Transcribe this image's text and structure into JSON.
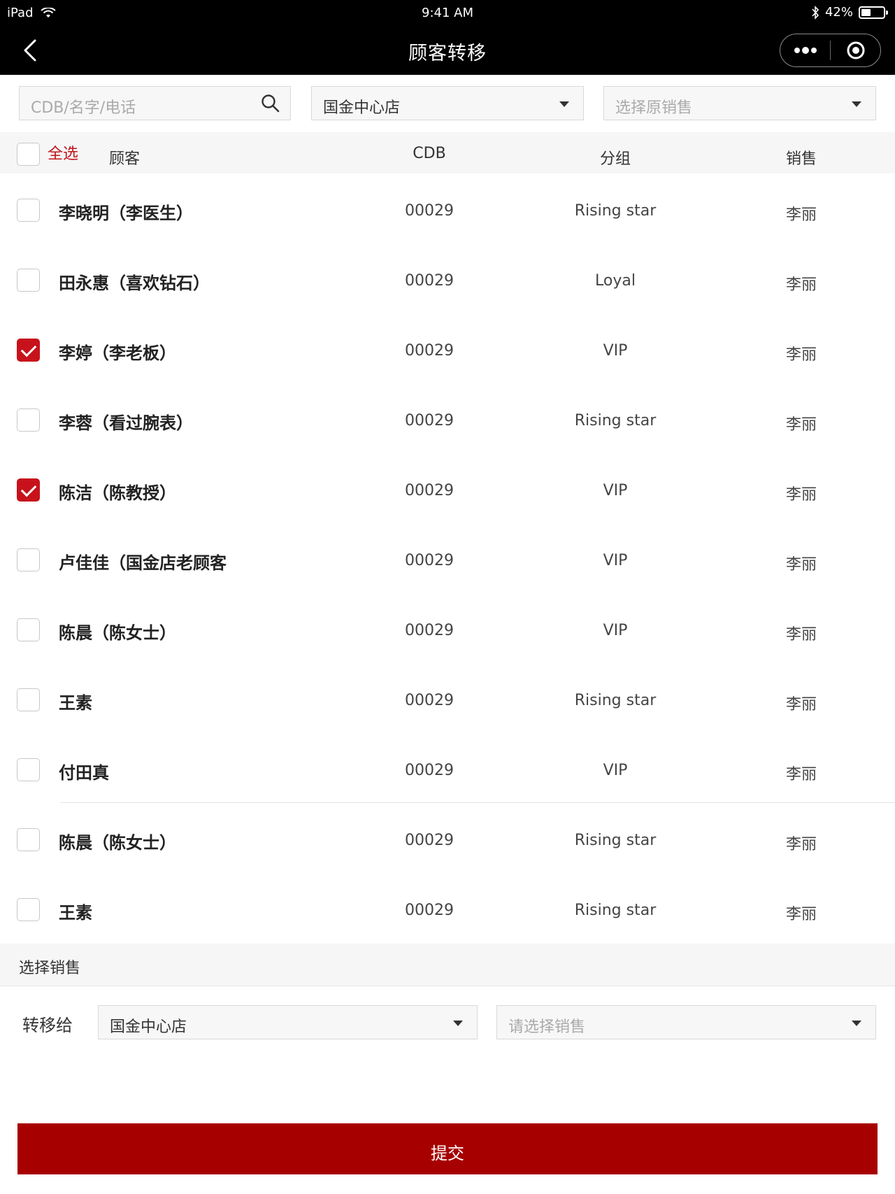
{
  "status_bar": {
    "device": "iPad",
    "time": "9:41 AM",
    "battery": "42%",
    "battery_level": 0.42
  },
  "navbar": {
    "title": "顾客转移",
    "back_icon": "chevron-left-icon",
    "more_icon": "more-dots-icon",
    "target_icon": "target-icon"
  },
  "filters": {
    "search_placeholder": "CDB/名字/电话",
    "store_value": "国金中心店",
    "original_sales_placeholder": "选择原销售"
  },
  "table": {
    "select_all_label": "全选",
    "headers": {
      "customer": "顾客",
      "cdb": "CDB",
      "group": "分组",
      "sales": "销售"
    },
    "rows": [
      {
        "name": "李晓明（李医生）",
        "cdb": "00029",
        "group": "Rising star",
        "sales": "李丽",
        "checked": false
      },
      {
        "name": "田永惠（喜欢钻石）",
        "cdb": "00029",
        "group": "Loyal",
        "sales": "李丽",
        "checked": false
      },
      {
        "name": "李婷（李老板）",
        "cdb": "00029",
        "group": "VIP",
        "sales": "李丽",
        "checked": true
      },
      {
        "name": "李蓉（看过腕表）",
        "cdb": "00029",
        "group": "Rising star",
        "sales": "李丽",
        "checked": false
      },
      {
        "name": "陈洁（陈教授）",
        "cdb": "00029",
        "group": "VIP",
        "sales": "李丽",
        "checked": true
      },
      {
        "name": "卢佳佳（国金店老顾客",
        "cdb": "00029",
        "group": "VIP",
        "sales": "李丽",
        "checked": false
      },
      {
        "name": "陈晨（陈女士）",
        "cdb": "00029",
        "group": "VIP",
        "sales": "李丽",
        "checked": false
      },
      {
        "name": "王素",
        "cdb": "00029",
        "group": "Rising star",
        "sales": "李丽",
        "checked": false
      },
      {
        "name": "付田真",
        "cdb": "00029",
        "group": "VIP",
        "sales": "李丽",
        "checked": false
      },
      {
        "name": "陈晨（陈女士）",
        "cdb": "00029",
        "group": "Rising star",
        "sales": "李丽",
        "checked": false
      },
      {
        "name": "王素",
        "cdb": "00029",
        "group": "Rising star",
        "sales": "李丽",
        "checked": false
      }
    ]
  },
  "select_sales": {
    "section_title": "选择销售",
    "transfer_label": "转移给",
    "store_value": "国金中心店",
    "sales_placeholder": "请选择销售"
  },
  "submit_label": "提交",
  "colors": {
    "accent": "#c8121b",
    "submit": "#a70000",
    "navbar": "#000000"
  }
}
